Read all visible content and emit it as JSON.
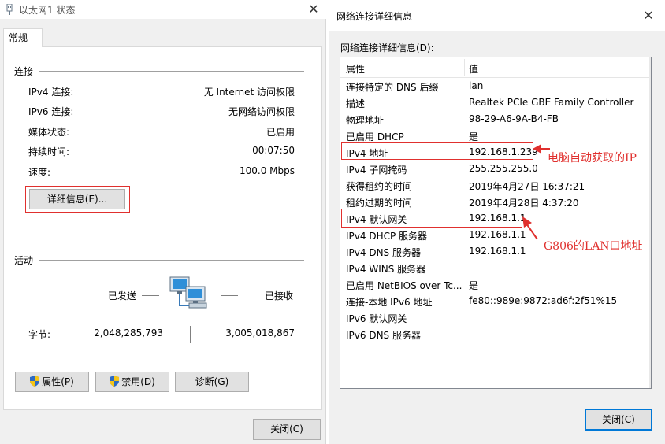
{
  "left_window": {
    "title": "以太网1 状态",
    "tab": "常规",
    "connection": {
      "heading": "连接",
      "rows": [
        {
          "label": "IPv4 连接:",
          "value": "无 Internet 访问权限"
        },
        {
          "label": "IPv6 连接:",
          "value": "无网络访问权限"
        },
        {
          "label": "媒体状态:",
          "value": "已启用"
        },
        {
          "label": "持续时间:",
          "value": "00:07:50"
        },
        {
          "label": "速度:",
          "value": "100.0 Mbps"
        }
      ],
      "details_button": "详细信息(E)..."
    },
    "activity": {
      "heading": "活动",
      "sent_label": "已发送",
      "received_label": "已接收",
      "bytes_label": "字节:",
      "bytes_sent": "2,048,285,793",
      "bytes_received": "3,005,018,867"
    },
    "buttons": {
      "properties": "属性(P)",
      "disable": "禁用(D)",
      "diagnose": "诊断(G)",
      "close": "关闭(C)"
    }
  },
  "right_window": {
    "title": "网络连接详细信息",
    "caption": "网络连接详细信息(D):",
    "columns": [
      "属性",
      "值"
    ],
    "rows": [
      {
        "property": "连接特定的 DNS 后缀",
        "value": "lan"
      },
      {
        "property": "描述",
        "value": "Realtek PCIe GBE Family Controller"
      },
      {
        "property": "物理地址",
        "value": "98-29-A6-9A-B4-FB"
      },
      {
        "property": "已启用 DHCP",
        "value": "是"
      },
      {
        "property": "IPv4 地址",
        "value": "192.168.1.239"
      },
      {
        "property": "IPv4 子网掩码",
        "value": "255.255.255.0"
      },
      {
        "property": "获得租约的时间",
        "value": "2019年4月27日 16:37:21"
      },
      {
        "property": "租约过期的时间",
        "value": "2019年4月28日 4:37:20"
      },
      {
        "property": "IPv4 默认网关",
        "value": "192.168.1.1"
      },
      {
        "property": "IPv4 DHCP 服务器",
        "value": "192.168.1.1"
      },
      {
        "property": "IPv4 DNS 服务器",
        "value": "192.168.1.1"
      },
      {
        "property": "IPv4 WINS 服务器",
        "value": ""
      },
      {
        "property": "已启用 NetBIOS over Tc...",
        "value": "是"
      },
      {
        "property": "连接-本地 IPv6 地址",
        "value": "fe80::989e:9872:ad6f:2f51%15"
      },
      {
        "property": "IPv6 默认网关",
        "value": ""
      },
      {
        "property": "IPv6 DNS 服务器",
        "value": ""
      }
    ],
    "close_button": "关闭(C)"
  },
  "annotations": {
    "ip_note": "电脑自动获取的IP",
    "gateway_note": "G806的LAN口地址",
    "color": "#e0302e"
  }
}
